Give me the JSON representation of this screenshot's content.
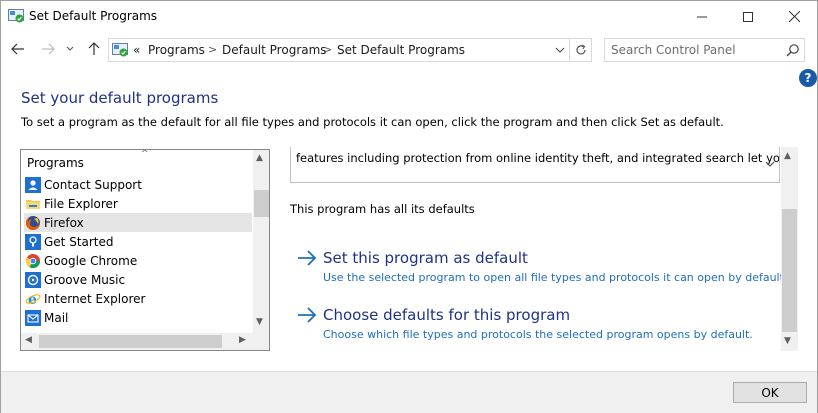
{
  "window": {
    "title": "Set Default Programs"
  },
  "address_bar": {
    "overflow": "«",
    "crumbs": [
      "Programs",
      "Default Programs",
      "Set Default Programs"
    ],
    "separator": ">"
  },
  "search": {
    "placeholder": "Search Control Panel"
  },
  "help": {
    "label": "?"
  },
  "page": {
    "heading": "Set your default programs",
    "instructions": "To set a program as the default for all file types and protocols it can open, click the program and then click Set as default."
  },
  "programs_list": {
    "header": "Programs",
    "items": [
      {
        "label": "Contact Support",
        "icon": "contact-support-icon"
      },
      {
        "label": "File Explorer",
        "icon": "file-explorer-icon"
      },
      {
        "label": "Firefox",
        "icon": "firefox-icon",
        "selected": true
      },
      {
        "label": "Get Started",
        "icon": "get-started-icon"
      },
      {
        "label": "Google Chrome",
        "icon": "chrome-icon"
      },
      {
        "label": "Groove Music",
        "icon": "groove-music-icon"
      },
      {
        "label": "Internet Explorer",
        "icon": "internet-explorer-icon"
      },
      {
        "label": "Mail",
        "icon": "mail-icon"
      }
    ]
  },
  "details": {
    "description": "features including protection from online identity theft, and integrated search let you",
    "status": "This program has all its defaults",
    "actions": [
      {
        "title": "Set this program as default",
        "subtitle": "Use the selected program to open all file types and protocols it can open by default."
      },
      {
        "title": "Choose defaults for this program",
        "subtitle": "Choose which file types and protocols the selected program opens by default."
      }
    ]
  },
  "footer": {
    "ok_label": "OK"
  },
  "colors": {
    "heading": "#1e3287",
    "link_sub": "#1e6ebd",
    "selection": "#e5e5e5"
  }
}
